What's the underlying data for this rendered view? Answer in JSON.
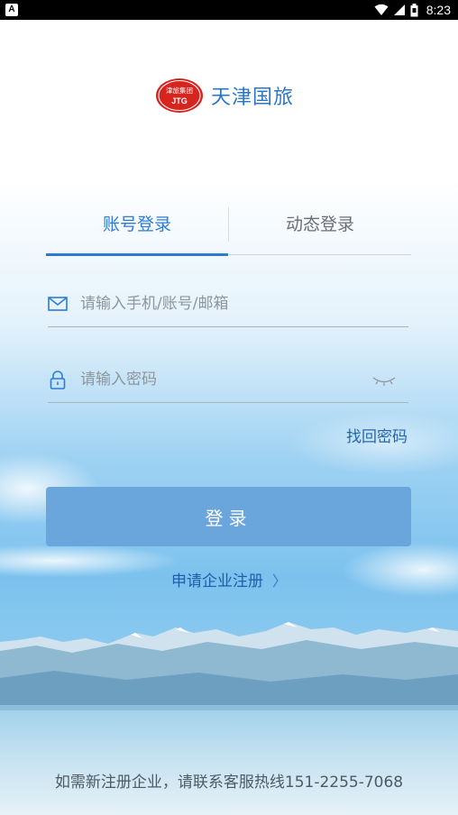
{
  "status_bar": {
    "notification_icon": "A",
    "time": "8:23",
    "icons": [
      "wifi-icon",
      "signal-icon",
      "battery-icon"
    ]
  },
  "logo": {
    "emblem_text_top": "津旅集团",
    "emblem_text_bottom": "JTG",
    "brand": "天津国旅"
  },
  "tabs": {
    "account": "账号登录",
    "dynamic": "动态登录",
    "active": "account"
  },
  "form": {
    "account_placeholder": "请输入手机/账号/邮箱",
    "account_value": "",
    "password_placeholder": "请输入密码",
    "password_value": "",
    "forgot_password": "找回密码"
  },
  "login_button": "登录",
  "register_link": "申请企业注册",
  "footer": "如需新注册企业，请联系客服热线151-2255-7068",
  "colors": {
    "accent": "#2d7bd6",
    "button": "#6aa6dc",
    "brand_red": "#d8241f"
  }
}
